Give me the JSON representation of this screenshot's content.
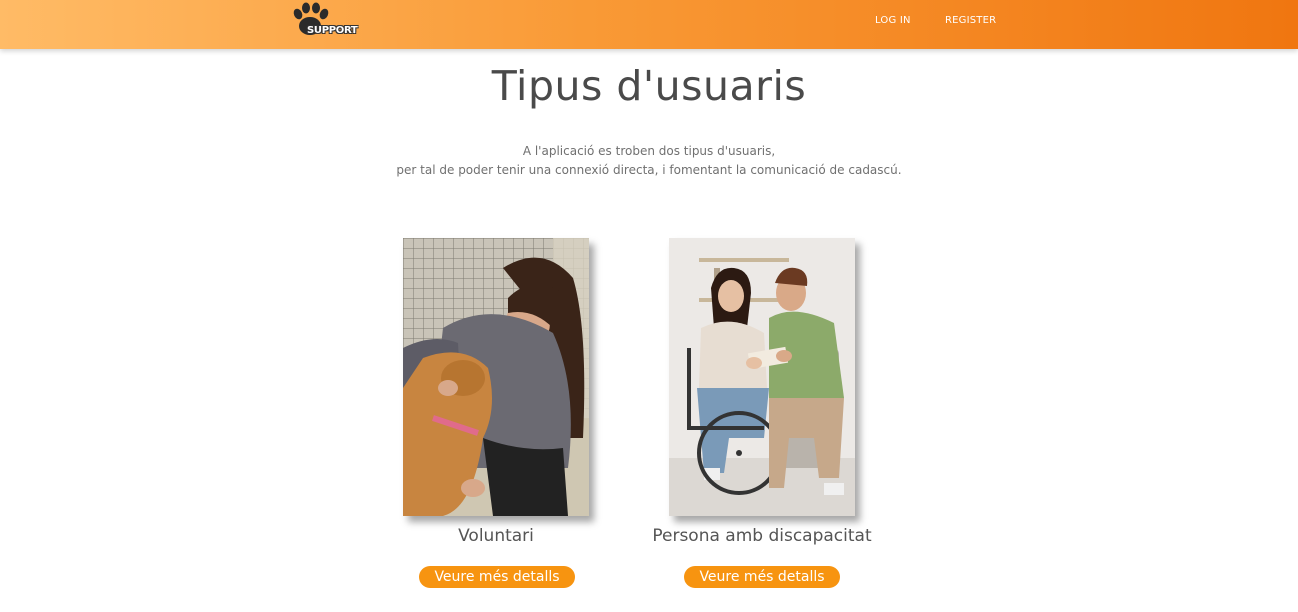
{
  "header": {
    "logo_text": "SUPPORT",
    "nav": {
      "login": "LOG IN",
      "register": "REGISTER"
    },
    "gradient_colors": [
      "#ffbb66",
      "#f07610"
    ]
  },
  "main": {
    "title": "Tipus d'usuaris",
    "intro_line1": "A l'aplicació es troben dos tipus d'usuaris,",
    "intro_line2": "per tal de poder tenir una connexió directa, i fomentant la comunicació de cadascú.",
    "cards": [
      {
        "title": "Voluntari",
        "button": "Veure més detalls",
        "image": "volunteer-with-dog-photo"
      },
      {
        "title": "Persona amb discapacitat",
        "button": "Veure més detalls",
        "image": "person-in-wheelchair-photo"
      }
    ],
    "accent_color": "#f79410"
  }
}
